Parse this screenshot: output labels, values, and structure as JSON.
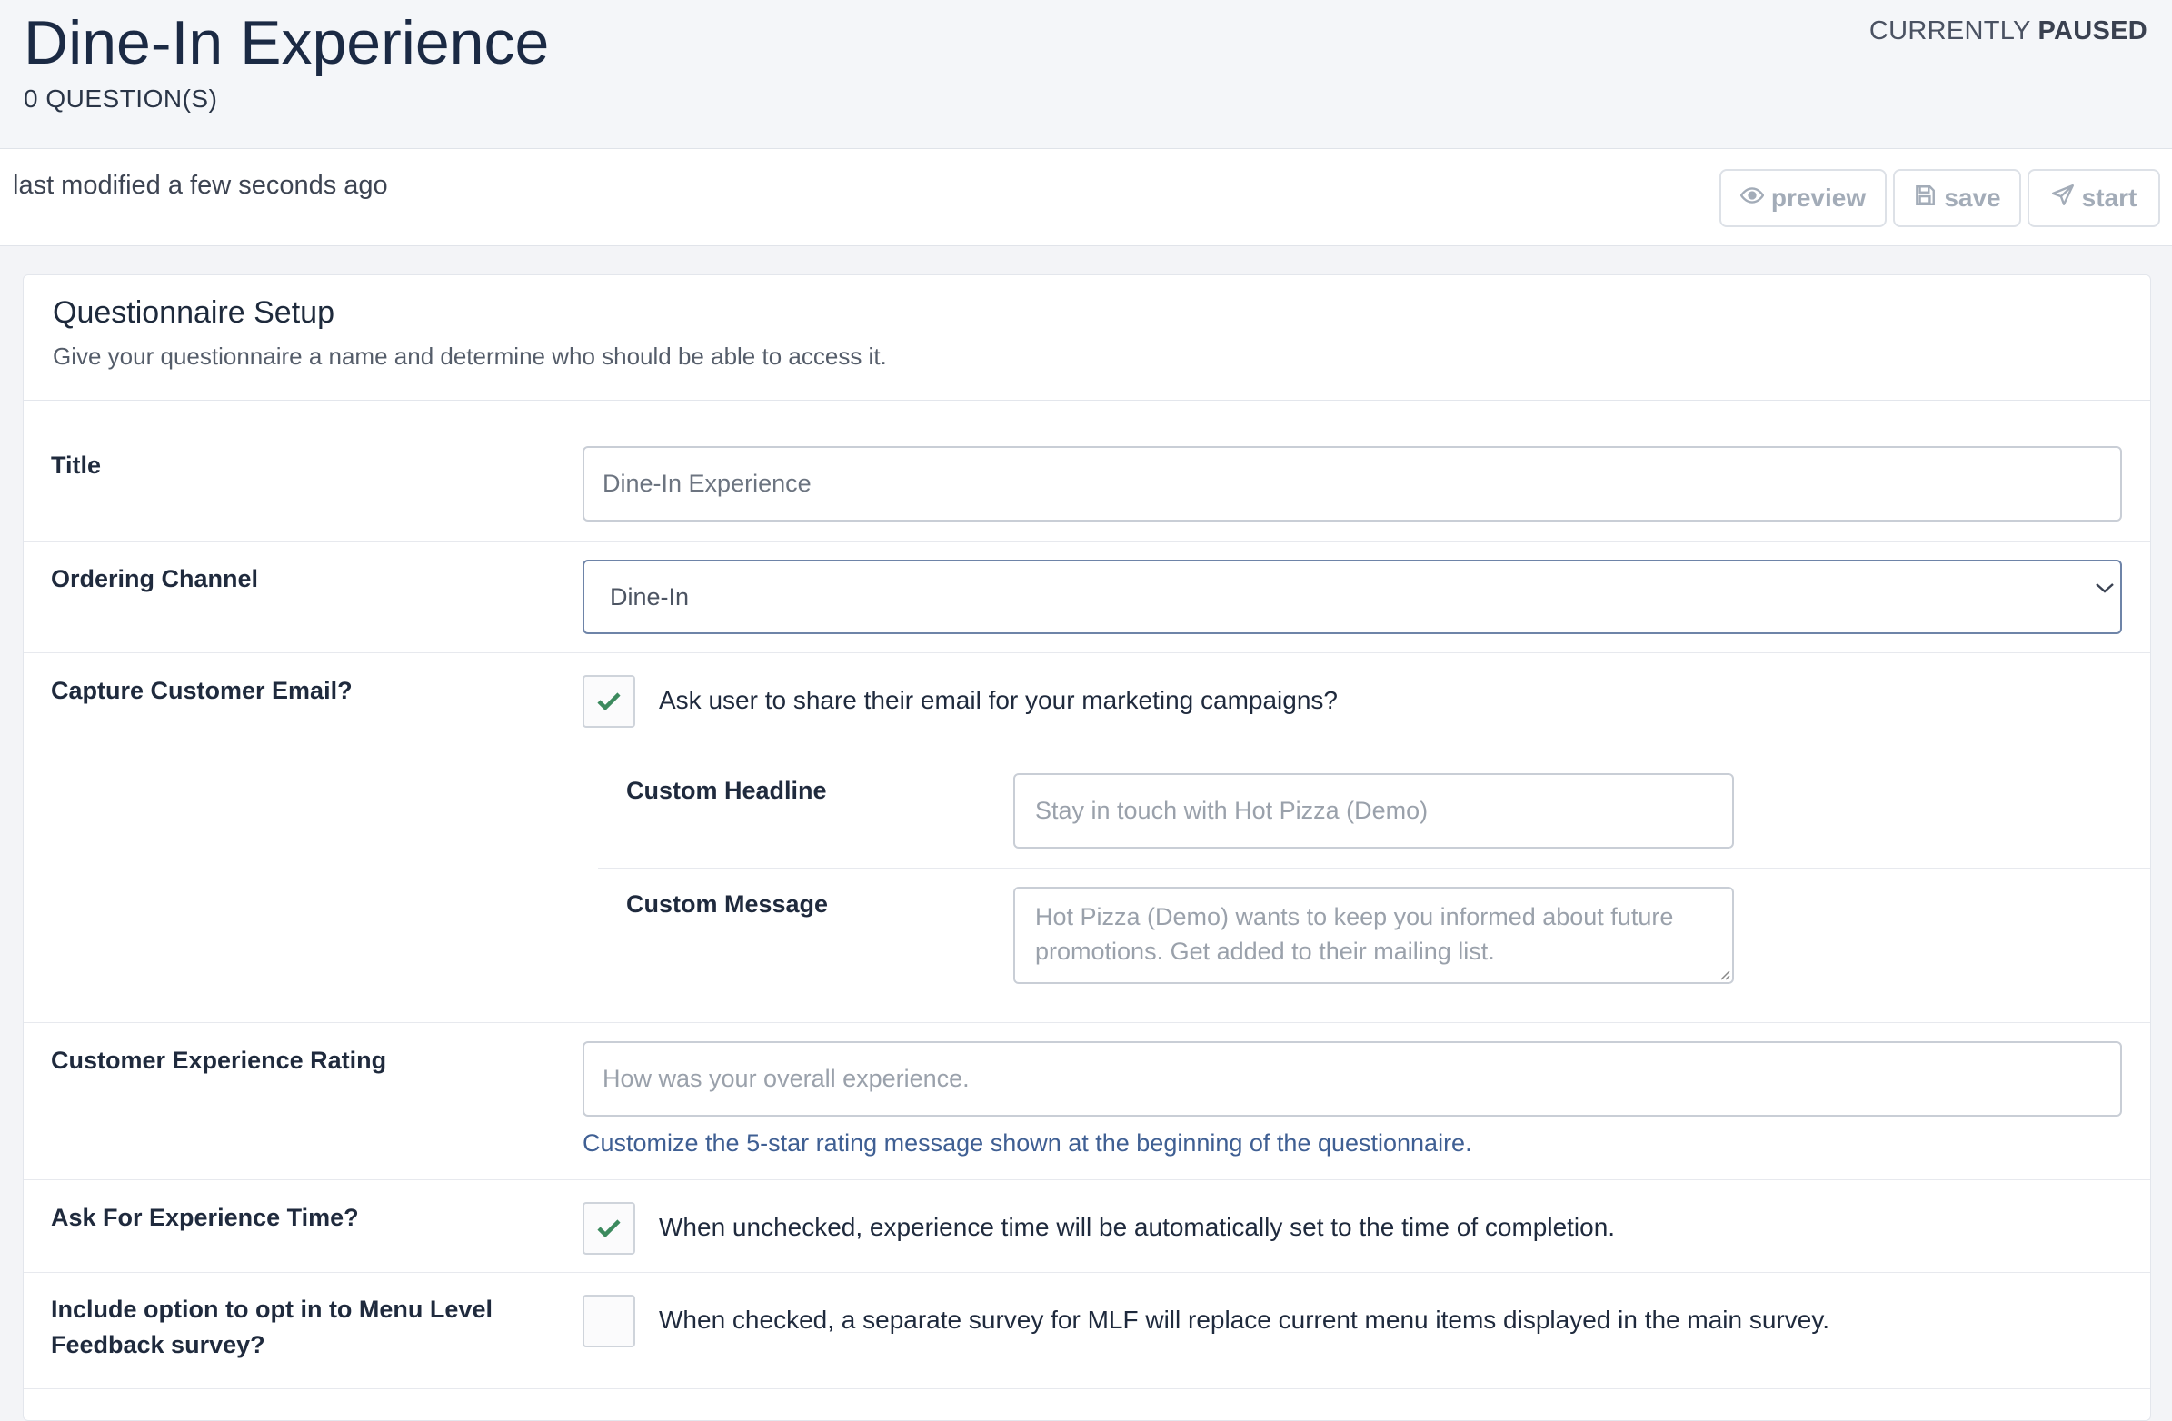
{
  "header": {
    "title": "Dine-In Experience",
    "question_count": "0 QUESTION(S)",
    "status_prefix": "CURRENTLY",
    "status_value": "PAUSED"
  },
  "toolbar": {
    "last_modified": "last modified a few seconds ago",
    "preview_label": "preview",
    "save_label": "save",
    "start_label": "start"
  },
  "setup": {
    "title": "Questionnaire Setup",
    "subtitle": "Give your questionnaire a name and determine who should be able to access it."
  },
  "fields": {
    "title": {
      "label": "Title",
      "value": "Dine-In Experience"
    },
    "ordering_channel": {
      "label": "Ordering Channel",
      "value": "Dine-In"
    },
    "capture_email": {
      "label": "Capture Customer Email?",
      "checked": true,
      "text": "Ask user to share their email for your marketing campaigns?",
      "headline_label": "Custom Headline",
      "headline_placeholder": "Stay in touch with Hot Pizza (Demo)",
      "message_label": "Custom Message",
      "message_placeholder": "Hot Pizza (Demo) wants to keep you informed about future promotions. Get added to their mailing list."
    },
    "experience_rating": {
      "label": "Customer Experience Rating",
      "placeholder": "How was your overall experience.",
      "hint": "Customize the 5-star rating message shown at the beginning of the questionnaire."
    },
    "experience_time": {
      "label": "Ask For Experience Time?",
      "checked": true,
      "text": "When unchecked, experience time will be automatically set to the time of completion."
    },
    "menu_level_feedback": {
      "label": "Include option to opt in to Menu Level Feedback survey?",
      "checked": false,
      "text": "When checked, a separate survey for MLF will replace current menu items displayed in the main survey."
    }
  },
  "colors": {
    "accent_check": "#3c8a5e",
    "hint": "#3f5f93"
  }
}
